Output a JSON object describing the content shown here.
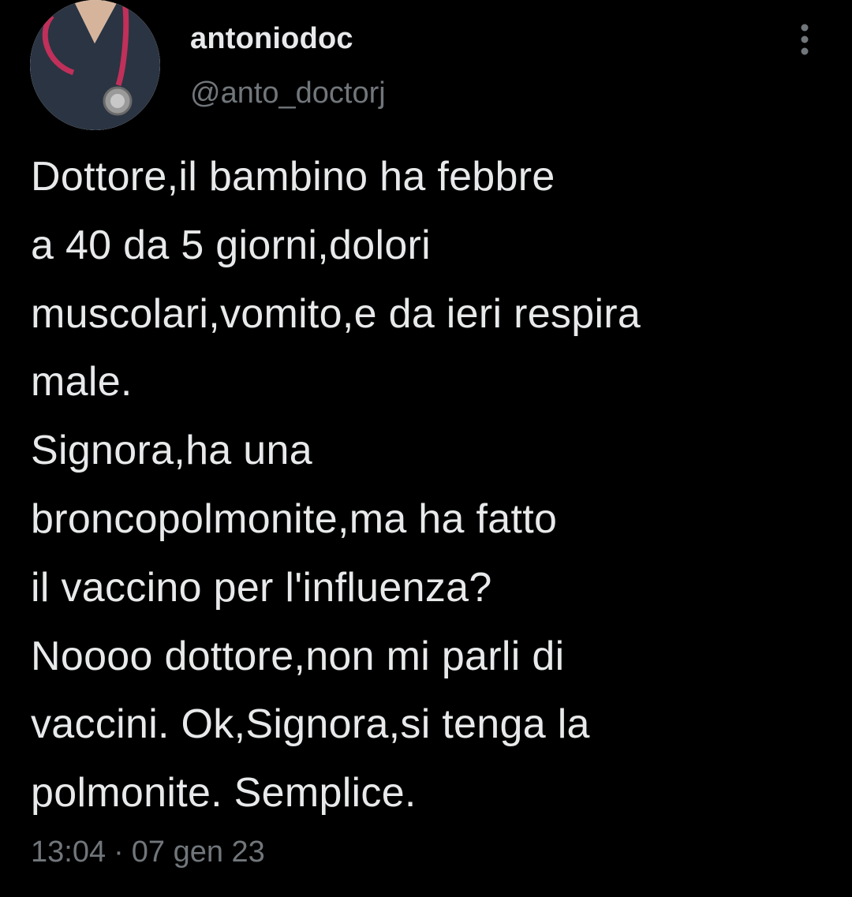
{
  "tweet": {
    "author": {
      "display_name": "antoniodoc",
      "handle": "@anto_doctorj",
      "avatar_icon": "doctor-avatar-photo"
    },
    "text": "Dottore,il bambino ha febbre\na 40 da 5 giorni,dolori\nmuscolari,vomito,e da ieri respira\nmale.\nSignora,ha una\nbroncopolmonite,ma ha fatto\nil vaccino per l'influenza?\nNoooo dottore,non mi parli di\nvaccini. Ok,Signora,si tenga la\npolmonite. Semplice.",
    "time": "13:04",
    "separator": "·",
    "date": "07 gen 23",
    "more_icon": "more-vertical-icon"
  },
  "colors": {
    "background": "#000000",
    "primary_text": "#e7e9ea",
    "secondary_text": "#71767b"
  }
}
